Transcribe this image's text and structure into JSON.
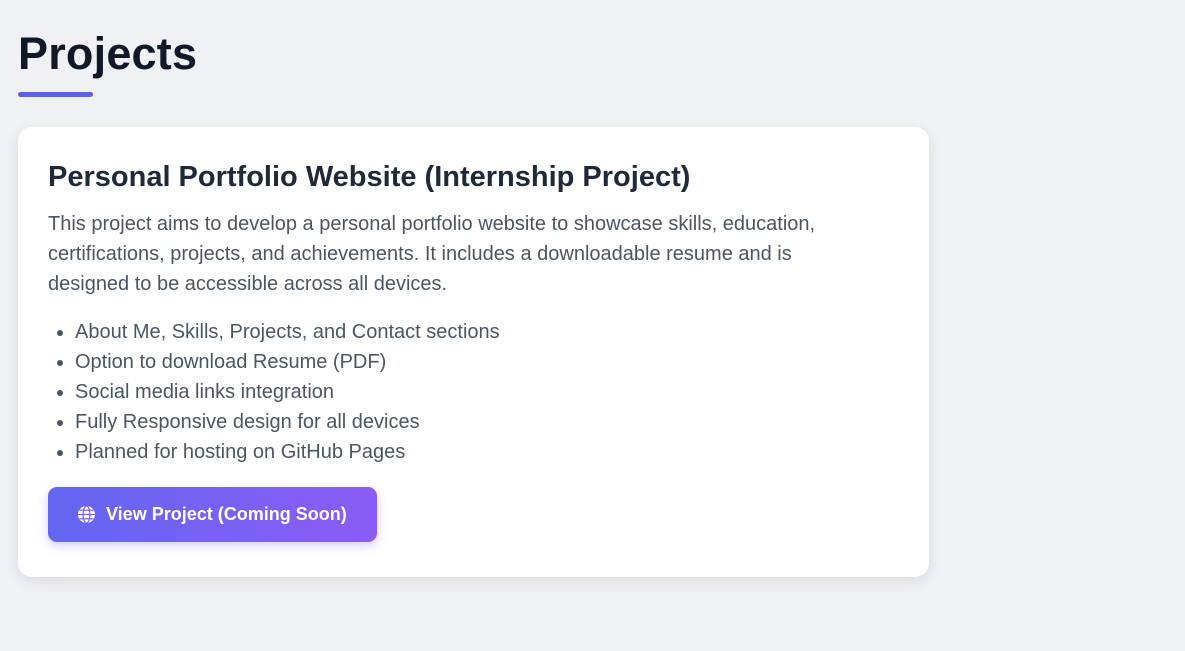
{
  "page": {
    "title": "Projects"
  },
  "project": {
    "title": "Personal Portfolio Website (Internship Project)",
    "description": "This project aims to develop a personal portfolio website to showcase skills, education, certifications, projects, and achievements. It includes a downloadable resume and is designed to be accessible across all devices.",
    "features": [
      "About Me, Skills, Projects, and Contact sections",
      "Option to download Resume (PDF)",
      "Social media links integration",
      "Fully Responsive design for all devices",
      "Planned for hosting on GitHub Pages"
    ],
    "button": {
      "label": "View Project (Coming Soon)",
      "icon": "globe-icon"
    }
  },
  "colors": {
    "accent": "#5b5fe3",
    "button_gradient_start": "#6366f1",
    "button_gradient_end": "#8b5cf6",
    "background": "#f0f1f5",
    "heading": "#111827",
    "body_text": "#4b5563"
  }
}
